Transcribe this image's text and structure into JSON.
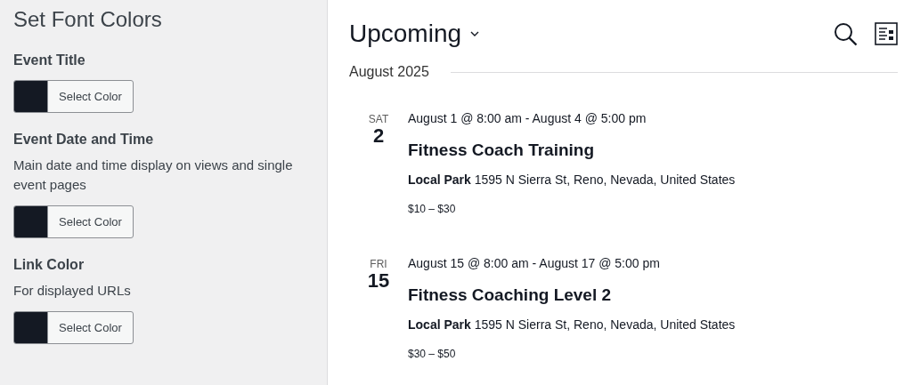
{
  "settings": {
    "title": "Set Font Colors",
    "fields": [
      {
        "label": "Event Title",
        "color": "#141923",
        "button": "Select Color"
      },
      {
        "label": "Event Date and Time",
        "description": "Main date and time display on views and single event pages",
        "color": "#141923",
        "button": "Select Color"
      },
      {
        "label": "Link Color",
        "description": "For displayed URLs",
        "color": "#141923",
        "button": "Select Color"
      }
    ]
  },
  "calendar": {
    "view": "Upcoming",
    "month": "August 2025",
    "events": [
      {
        "weekday": "SAT",
        "day": "2",
        "datetime": "August 1 @ 8:00 am - August 4 @ 5:00 pm",
        "title": "Fitness Coach Training",
        "venue": "Local Park",
        "address": "1595 N Sierra St, Reno, Nevada, United States",
        "price": "$10 – $30"
      },
      {
        "weekday": "FRI",
        "day": "15",
        "datetime": "August 15 @ 8:00 am - August 17 @ 5:00 pm",
        "title": "Fitness Coaching Level 2",
        "venue": "Local Park",
        "address": "1595 N Sierra St, Reno, Nevada, United States",
        "price": "$30 – $50"
      }
    ]
  }
}
